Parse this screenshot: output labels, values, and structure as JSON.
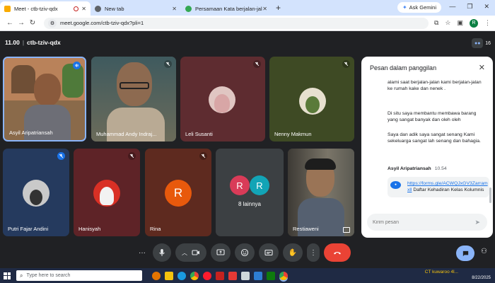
{
  "browser": {
    "tabs": [
      {
        "title": "Meet - ctb-tziv-qdx",
        "active": true,
        "favicon_color": "#f9ab00"
      },
      {
        "title": "New tab",
        "active": false,
        "favicon_color": "#5f6368"
      },
      {
        "title": "Persamaan Kata berjalan-jalan",
        "active": false,
        "favicon_color": "#34a853"
      }
    ],
    "new_tab_glyph": "+",
    "gemini_label": "Ask Gemini",
    "url": "meet.google.com/ctb-tziv-qdx?pli=1",
    "profile_initial": "R"
  },
  "meeting": {
    "time": "11.00",
    "code": "ctb-tziv-qdx",
    "participants_count": "16"
  },
  "tiles": [
    {
      "name": "Asyil Aripatriansah",
      "bg": "#8a6a4a",
      "kind": "video",
      "speaking": true
    },
    {
      "name": "Muhammad Andy Indraj...",
      "bg": "#4d5c58",
      "kind": "video",
      "muted": true
    },
    {
      "name": "Leli Susanti",
      "bg": "#5e2c30",
      "kind": "avatar",
      "muted": true
    },
    {
      "name": "Nenny Makmun",
      "bg": "#3e4a24",
      "kind": "avatar",
      "muted": true
    },
    {
      "name": "Putri Fajar Andini",
      "bg": "#253a5e",
      "kind": "avatar",
      "muted": true
    },
    {
      "name": "Hanisyah",
      "bg": "#5e2327",
      "kind": "avatar",
      "muted": true
    },
    {
      "name": "Rina",
      "bg": "#5e2a1f",
      "kind": "letter",
      "letter": "R",
      "muted": true
    },
    {
      "name": "8 lainnya",
      "bg": "#3c4043",
      "kind": "group",
      "letters": [
        "R",
        "R"
      ]
    },
    {
      "name": "Restiaweni",
      "bg": "#4f4f4a",
      "kind": "video"
    }
  ],
  "chat": {
    "title": "Pesan dalam panggilan",
    "messages": [
      "alami saat berjalan-jalan kami berjalan-jalan ke rumah kake dan nenek .",
      "Di situ saya membantu membawa barang yang sangat banyak dan oleh oleh",
      "Saya dan adik saya sangat senang Kami sekeluarga sangat lah senang dan bahagia."
    ],
    "sender": "Asyil Aripatriansah",
    "sender_time": "10.54",
    "link_text": "https://forms.gle/ACWQJxGV3Zarram",
    "link_suffix": "xll",
    "link_rest": "Daftar Kehadiran Kelas Kolumnis",
    "input_placeholder": "Kirim pesan"
  },
  "taskbar": {
    "search_placeholder": "Type here to search",
    "tray_label": "CT kuwaroo 4l...",
    "date": "8/22/2025"
  },
  "colors": {
    "meet_bg": "#202124",
    "hangup": "#ea4335",
    "accent": "#8ab4f8"
  }
}
